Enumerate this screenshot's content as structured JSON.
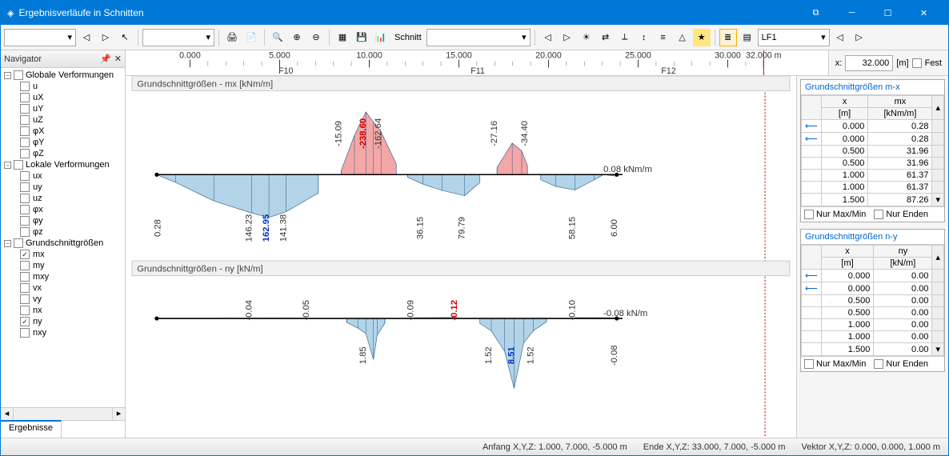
{
  "window": {
    "title": "Ergebnisverläufe in Schnitten"
  },
  "nav": {
    "title": "Navigator",
    "tab": "Ergebnisse",
    "groups": [
      {
        "label": "Globale Verformungen",
        "items": [
          {
            "id": "u",
            "lbl": "u",
            "chk": false
          },
          {
            "id": "uX",
            "lbl": "uX",
            "chk": false
          },
          {
            "id": "uY",
            "lbl": "uY",
            "chk": false
          },
          {
            "id": "uZ",
            "lbl": "uZ",
            "chk": false
          },
          {
            "id": "phiX",
            "lbl": "φX",
            "chk": false
          },
          {
            "id": "phiY",
            "lbl": "φY",
            "chk": false
          },
          {
            "id": "phiZ",
            "lbl": "φZ",
            "chk": false
          }
        ]
      },
      {
        "label": "Lokale Verformungen",
        "items": [
          {
            "id": "lux",
            "lbl": "ux",
            "chk": false
          },
          {
            "id": "luy",
            "lbl": "uy",
            "chk": false
          },
          {
            "id": "luz",
            "lbl": "uz",
            "chk": false
          },
          {
            "id": "lphix",
            "lbl": "φx",
            "chk": false
          },
          {
            "id": "lphiy",
            "lbl": "φy",
            "chk": false
          },
          {
            "id": "lphiz",
            "lbl": "φz",
            "chk": false
          }
        ]
      },
      {
        "label": "Grundschnittgrößen",
        "items": [
          {
            "id": "mx",
            "lbl": "mx",
            "chk": true
          },
          {
            "id": "my",
            "lbl": "my",
            "chk": false
          },
          {
            "id": "mxy",
            "lbl": "mxy",
            "chk": false
          },
          {
            "id": "vx",
            "lbl": "vx",
            "chk": false
          },
          {
            "id": "vy",
            "lbl": "vy",
            "chk": false
          },
          {
            "id": "nx",
            "lbl": "nx",
            "chk": false
          },
          {
            "id": "ny",
            "lbl": "ny",
            "chk": true
          },
          {
            "id": "nxy",
            "lbl": "nxy",
            "chk": false
          }
        ]
      }
    ]
  },
  "ruler": {
    "ticks": [
      "0.000",
      "5.000",
      "10.000",
      "15.000",
      "20.000",
      "25.000",
      "30.000",
      "32.000 m"
    ],
    "spans": [
      "F10",
      "F11",
      "F12"
    ],
    "x_label": "x:",
    "x_value": "32.000",
    "x_unit": "[m]",
    "fix_label": "Fest"
  },
  "toolbar": {
    "section_label": "Schnitt",
    "lf_label": "LF1"
  },
  "chart_data": [
    {
      "type": "area",
      "title": "Grundschnittgrößen - mx [kNm/m]",
      "x_range": [
        0,
        32
      ],
      "zero_y": 0,
      "labels": {
        "0.28": {
          "x": 0.2,
          "v": "0.28",
          "side": "below"
        },
        "146.23": {
          "x": 5.0,
          "v": "146.23",
          "side": "below"
        },
        "162.95": {
          "x": 5.9,
          "v": "162.95",
          "side": "below",
          "bold": true
        },
        "141.38": {
          "x": 6.8,
          "v": "141.38",
          "side": "below"
        },
        "-15.09": {
          "x": 9.7,
          "v": "-15.09",
          "side": "above"
        },
        "-238.60": {
          "x": 11.0,
          "v": "-238.60",
          "side": "above",
          "red": true
        },
        "-162.64": {
          "x": 11.8,
          "v": "-162.64",
          "side": "above"
        },
        "36.15": {
          "x": 14.0,
          "v": "36.15",
          "side": "below"
        },
        "79.79": {
          "x": 16.2,
          "v": "79.79",
          "side": "below"
        },
        "-27.16": {
          "x": 17.9,
          "v": "-27.16",
          "side": "above"
        },
        "-34.40": {
          "x": 19.5,
          "v": "-34.40",
          "side": "above"
        },
        "58.15": {
          "x": 22.0,
          "v": "58.15",
          "side": "below"
        },
        "0.08 kNm/m": {
          "x": 23.5,
          "v": "0.08 kNm/m",
          "side": "axis"
        },
        "6.00": {
          "x": 24.2,
          "v": "6.00",
          "side": "below"
        }
      },
      "pos_color": "#f4a7a7",
      "neg_color": "#b3d4e8"
    },
    {
      "type": "area",
      "title": "Grundschnittgrößen - ny [kN/m]",
      "x_range": [
        0,
        32
      ],
      "zero_y": 0,
      "labels": {
        "-0.04": {
          "x": 5.0,
          "v": "-0.04",
          "side": "above"
        },
        "-0.05": {
          "x": 8.0,
          "v": "-0.05",
          "side": "above"
        },
        "1.85": {
          "x": 11.0,
          "v": "1.85",
          "side": "below"
        },
        "-0.09": {
          "x": 13.5,
          "v": "-0.09",
          "side": "above"
        },
        "-0.12": {
          "x": 15.8,
          "v": "-0.12",
          "side": "above",
          "red": true
        },
        "1.52a": {
          "x": 17.6,
          "v": "1.52",
          "side": "below"
        },
        "8.51": {
          "x": 18.8,
          "v": "8.51",
          "side": "below",
          "bold": true
        },
        "1.52b": {
          "x": 19.8,
          "v": "1.52",
          "side": "below"
        },
        "-0.10": {
          "x": 22.0,
          "v": "-0.10",
          "side": "above"
        },
        "-0.08 kN/m": {
          "x": 23.5,
          "v": "-0.08 kN/m",
          "side": "axis"
        },
        "-0.08": {
          "x": 24.2,
          "v": "-0.08",
          "side": "below"
        }
      },
      "pos_color": "#f4a7a7",
      "neg_color": "#b3d4e8"
    }
  ],
  "tables": {
    "mx": {
      "title": "Grundschnittgrößen m-x",
      "head_x": "x\n[m]",
      "head_v": "mx\n[kNm/m]",
      "rows": [
        {
          "mark": true,
          "x": "0.000",
          "v": "0.28"
        },
        {
          "mark": true,
          "x": "0.000",
          "v": "0.28"
        },
        {
          "mark": false,
          "x": "0.500",
          "v": "31.96"
        },
        {
          "mark": false,
          "x": "0.500",
          "v": "31.96"
        },
        {
          "mark": false,
          "x": "1.000",
          "v": "61.37"
        },
        {
          "mark": false,
          "x": "1.000",
          "v": "61.37"
        },
        {
          "mark": false,
          "x": "1.500",
          "v": "87.26"
        }
      ],
      "foot_a": "Nur Max/Min",
      "foot_b": "Nur Enden"
    },
    "ny": {
      "title": "Grundschnittgrößen n-y",
      "head_x": "x\n[m]",
      "head_v": "ny\n[kN/m]",
      "rows": [
        {
          "mark": true,
          "x": "0.000",
          "v": "0.00"
        },
        {
          "mark": true,
          "x": "0.000",
          "v": "0.00"
        },
        {
          "mark": false,
          "x": "0.500",
          "v": "0.00"
        },
        {
          "mark": false,
          "x": "0.500",
          "v": "0.00"
        },
        {
          "mark": false,
          "x": "1.000",
          "v": "0.00"
        },
        {
          "mark": false,
          "x": "1.000",
          "v": "0.00"
        },
        {
          "mark": false,
          "x": "1.500",
          "v": "0.00"
        }
      ],
      "foot_a": "Nur Max/Min",
      "foot_b": "Nur Enden"
    }
  },
  "status": {
    "start": "Anfang X,Y,Z:   1.000, 7.000, -5.000 m",
    "end": "Ende X,Y,Z:   33.000, 7.000, -5.000 m",
    "vec": "Vektor X,Y,Z:   0.000, 0.000, 1.000 m"
  }
}
